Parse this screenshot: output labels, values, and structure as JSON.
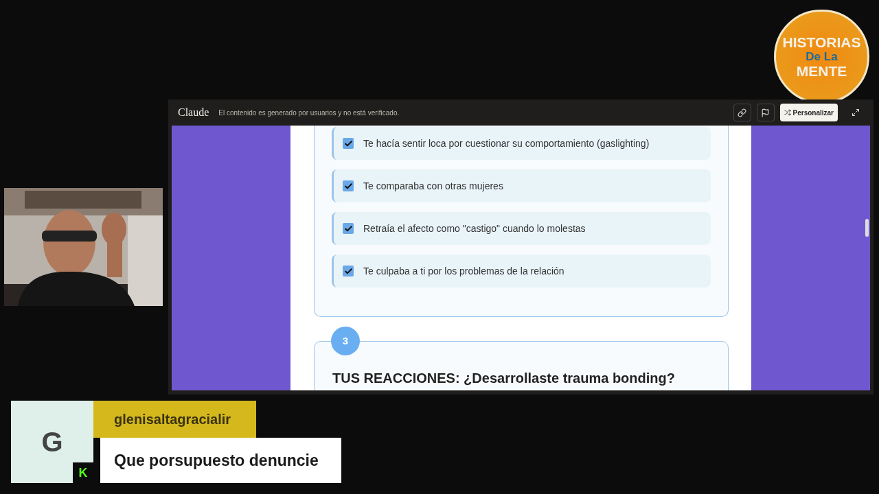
{
  "logo": {
    "lines": [
      "HISTORIAS",
      "De La",
      "MENTE"
    ]
  },
  "window": {
    "app_name": "Claude",
    "notice": "El contenido es generado por usuarios y no está verificado.",
    "customize_button": "Personalizar"
  },
  "checklist": [
    {
      "text": "Te hacía sentir loca por cuestionar su comportamiento (gaslighting)",
      "checked": true
    },
    {
      "text": "Te comparaba con otras mujeres",
      "checked": true
    },
    {
      "text": "Retraía el afecto como \"castigo\" cuando lo molestas",
      "checked": true
    },
    {
      "text": "Te culpaba a ti por los problemas de la relación",
      "checked": true
    }
  ],
  "section": {
    "number": "3",
    "title": "TUS REACCIONES: ¿Desarrollaste trauma bonding?"
  },
  "chat": {
    "avatar_letter": "G",
    "platform_badge": "K",
    "username": "glenisaltagracialir",
    "message": "Que porsupuesto denuncie"
  }
}
